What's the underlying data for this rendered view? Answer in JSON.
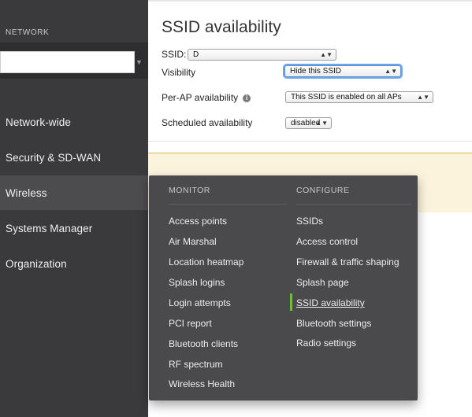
{
  "sidebar": {
    "network_label": "NETWORK",
    "network_select_value": "",
    "items": [
      {
        "label": "Network-wide"
      },
      {
        "label": "Security & SD-WAN"
      },
      {
        "label": "Wireless"
      },
      {
        "label": "Systems Manager"
      },
      {
        "label": "Organization"
      }
    ],
    "active_item": "Wireless"
  },
  "main": {
    "title": "SSID availability",
    "form": {
      "ssid_label": "SSID:",
      "ssid_value": "D",
      "visibility_label": "Visibility",
      "visibility_value": "Hide this SSID",
      "per_ap_label": "Per-AP availability",
      "per_ap_value": "This SSID is enabled on all APs",
      "scheduled_label": "Scheduled availability",
      "scheduled_value": "disabled"
    }
  },
  "flyout": {
    "monitor_header": "MONITOR",
    "configure_header": "CONFIGURE",
    "monitor_items": [
      {
        "label": "Access points"
      },
      {
        "label": "Air Marshal"
      },
      {
        "label": "Location heatmap"
      },
      {
        "label": "Splash logins"
      },
      {
        "label": "Login attempts"
      },
      {
        "label": "PCI report"
      },
      {
        "label": "Bluetooth clients"
      },
      {
        "label": "RF spectrum"
      },
      {
        "label": "Wireless Health"
      }
    ],
    "configure_items": [
      {
        "label": "SSIDs"
      },
      {
        "label": "Access control"
      },
      {
        "label": "Firewall & traffic shaping"
      },
      {
        "label": "Splash page"
      },
      {
        "label": "SSID availability"
      },
      {
        "label": "Bluetooth settings"
      },
      {
        "label": "Radio settings"
      }
    ],
    "current_item": "SSID availability"
  },
  "colors": {
    "sidebar_bg": "#3a3a3c",
    "flyout_bg": "#4a4a4d",
    "active_indicator": "#67c23a",
    "warning_bg": "#fbf3dc"
  },
  "icons": {
    "info": "info-icon",
    "select_arrows": "updown-arrows-icon"
  }
}
